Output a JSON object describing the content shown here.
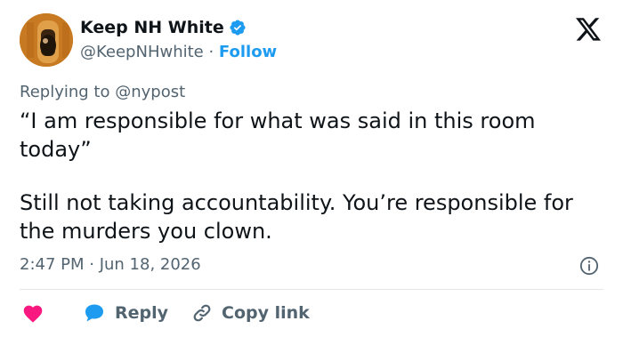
{
  "author": {
    "name": "Keep NH White",
    "handle": "@KeepNHwhite",
    "separator": " · ",
    "follow_label": "Follow",
    "verified": true
  },
  "reply_context": {
    "prefix": "Replying to ",
    "mention": "@nypost"
  },
  "tweet": {
    "paragraph_1": "“I am responsible for what was said in this room today”",
    "paragraph_2": "Still not taking accountability. You’re responsible for the murders you clown."
  },
  "timestamp": "2:47 PM · Jun 18, 2026",
  "actions": {
    "reply_label": "Reply",
    "copy_link_label": "Copy link"
  },
  "colors": {
    "accent": "#1d9bf0",
    "heart": "#f91880",
    "muted": "#536471",
    "text": "#0f1419"
  },
  "icons": [
    "verified-badge-icon",
    "x-logo-icon",
    "info-icon",
    "heart-icon",
    "reply-bubble-icon",
    "link-icon"
  ]
}
